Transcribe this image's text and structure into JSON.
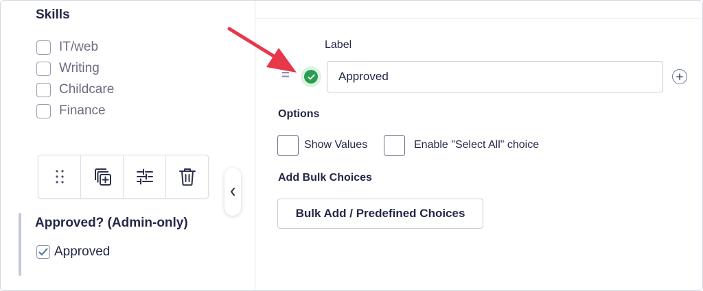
{
  "left_panel": {
    "skills_field": {
      "title": "Skills",
      "choices": [
        "IT/web",
        "Writing",
        "Childcare",
        "Finance"
      ]
    },
    "field_toolbar": {
      "icons": [
        "drag-handle-icon",
        "duplicate-icon",
        "settings-icon",
        "trash-icon"
      ]
    },
    "admin_field": {
      "title": "Approved? (Admin-only)",
      "choice_label": "Approved",
      "checked": true
    },
    "collapse_icon": "chevron-left-icon"
  },
  "right_panel": {
    "label_heading": "Label",
    "choice_value": "Approved",
    "options_heading": "Options",
    "show_values_label": "Show Values",
    "select_all_label": "Enable \"Select All\" choice",
    "bulk_heading": "Add Bulk Choices",
    "bulk_button_label": "Bulk Add / Predefined Choices"
  },
  "colors": {
    "text": "#242748",
    "muted_text": "#6b6d80",
    "accent_green": "#2a9d4f",
    "arrow_red": "#e8374a",
    "border": "#c9cbd6"
  }
}
